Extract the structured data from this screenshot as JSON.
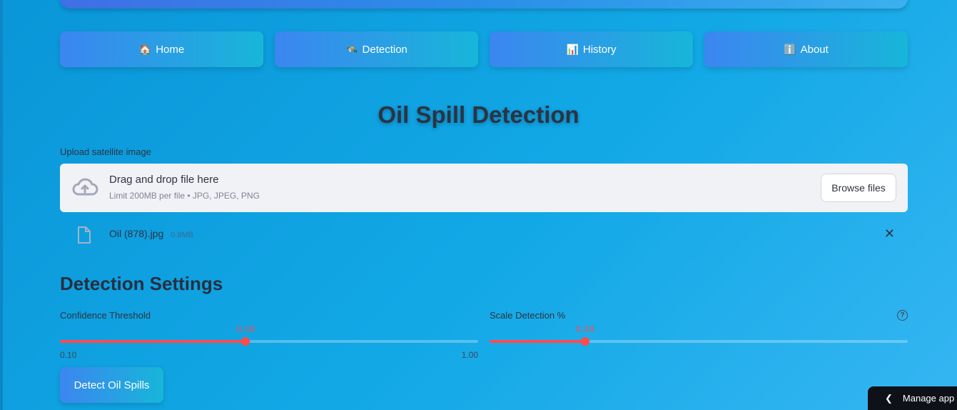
{
  "nav": {
    "items": [
      {
        "icon": "🏠",
        "label": "Home"
      },
      {
        "icon": "🛰️",
        "label": "Detection"
      },
      {
        "icon": "📊",
        "label": "History"
      },
      {
        "icon": "ℹ️",
        "label": "About"
      }
    ]
  },
  "page": {
    "title": "Oil Spill Detection"
  },
  "upload": {
    "label": "Upload satellite image",
    "drop_title": "Drag and drop file here",
    "drop_subtitle": "Limit 200MB per file • JPG, JPEG, PNG",
    "browse_label": "Browse files",
    "file": {
      "name": "Oil (878).jpg",
      "size": "0.8MB"
    },
    "remove_glyph": "✕"
  },
  "settings": {
    "title": "Detection Settings",
    "confidence": {
      "label": "Confidence Threshold",
      "value": "0.50",
      "min": "0.10",
      "max": "1.00",
      "value_num": 0.5,
      "min_num": 0.1,
      "max_num": 1.0
    },
    "scale": {
      "label": "Scale Detection %",
      "value": "0.30",
      "fill_fraction": 0.228,
      "help_glyph": "?"
    }
  },
  "detect_button": {
    "label": "Detect Oil Spills"
  },
  "manage_app": {
    "glyph": "❮",
    "label": "Manage app"
  },
  "colors": {
    "accent": "#ff4b4b",
    "button_gradient_start": "#3c86f0",
    "button_gradient_end": "#17b6d9",
    "background": "#12a8e6"
  }
}
